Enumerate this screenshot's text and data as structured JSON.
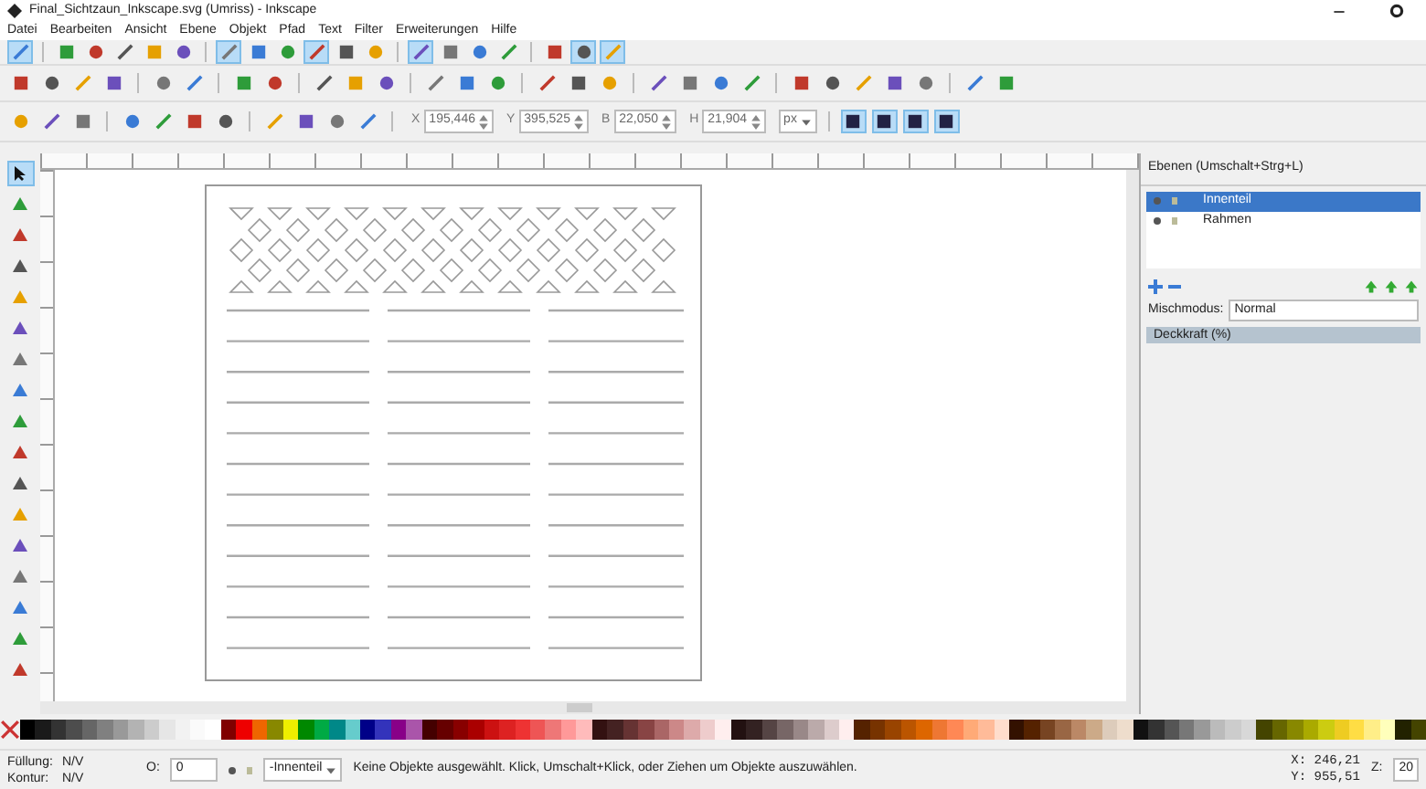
{
  "window": {
    "title": "Final_Sichtzaun_Inkscape.svg (Umriss) - Inkscape"
  },
  "menu": [
    "Datei",
    "Bearbeiten",
    "Ansicht",
    "Ebene",
    "Objekt",
    "Pfad",
    "Text",
    "Filter",
    "Erweiterungen",
    "Hilfe"
  ],
  "snap_toolbar": [
    {
      "on": true
    },
    {
      "on": false
    },
    {
      "on": false
    },
    {
      "on": false
    },
    {
      "on": false
    },
    {
      "on": false
    },
    {
      "on": true
    },
    {
      "on": false
    },
    {
      "on": false
    },
    {
      "on": true
    },
    {
      "on": false
    },
    {
      "on": false
    },
    {
      "on": true
    },
    {
      "on": false
    },
    {
      "on": false
    },
    {
      "on": false
    },
    {
      "on": false
    },
    {
      "on": true
    },
    {
      "on": true
    }
  ],
  "selector_toolbar": {
    "fields": [
      {
        "label": "X",
        "value": "195,446"
      },
      {
        "label": "Y",
        "value": "395,525"
      },
      {
        "label": "B",
        "value": "22,050"
      },
      {
        "label": "H",
        "value": "21,904"
      }
    ],
    "unit": "px",
    "toggles": [
      {
        "on": true
      },
      {
        "on": true
      },
      {
        "on": true
      },
      {
        "on": true
      }
    ]
  },
  "tools": [
    {
      "selected": true
    },
    {
      "selected": false
    },
    {
      "selected": false
    },
    {
      "selected": false
    },
    {
      "selected": false
    },
    {
      "selected": false
    },
    {
      "selected": false
    },
    {
      "selected": false
    },
    {
      "selected": false
    },
    {
      "selected": false
    },
    {
      "selected": false
    },
    {
      "selected": false
    },
    {
      "selected": false
    },
    {
      "selected": false
    },
    {
      "selected": false
    },
    {
      "selected": false
    },
    {
      "selected": false
    }
  ],
  "layers_panel": {
    "title": "Ebenen (Umschalt+Strg+L)",
    "layers": [
      {
        "name": "Innenteil",
        "selected": true
      },
      {
        "name": "Rahmen",
        "selected": false
      }
    ],
    "blend_label": "Mischmodus:",
    "blend_value": "Normal",
    "opacity_label": "Deckkraft (%)",
    "level": 1
  },
  "status_bar": {
    "fill_label": "Füllung:",
    "fill_value": "N/V",
    "stroke_label": "Kontur:",
    "stroke_value": "N/V",
    "opacity_label": "O:",
    "opacity_value": "0",
    "layer": "-Innenteil",
    "message": "Keine Objekte ausgewählt. Klick, Umschalt+Klick, oder Ziehen um Objekte auszuwählen.",
    "x": "X: 246,21",
    "y": "Y: 955,51",
    "zoom_label": "Z:",
    "zoom_value": "20"
  }
}
